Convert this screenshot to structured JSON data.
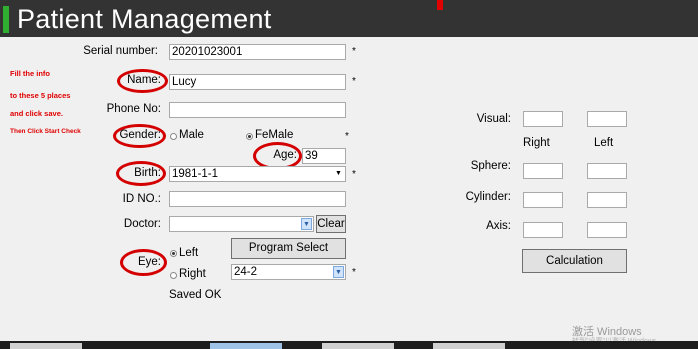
{
  "header": {
    "title": "Patient Management"
  },
  "hints": [
    "Fill the info",
    "to these 5 places",
    "and click save.",
    "Then Click Start Check"
  ],
  "form": {
    "serial_label": "Serial number:",
    "serial_value": "20201023001",
    "name_label": "Name:",
    "name_value": "Lucy",
    "phone_label": "Phone No:",
    "phone_value": "",
    "gender_label": "Gender:",
    "gender_male": "Male",
    "gender_female": "FeMale",
    "gender_selected": "FeMale",
    "age_label": "Age:",
    "age_value": "39",
    "birth_label": "Birth:",
    "birth_value": "1981-1-1",
    "id_label": "ID NO.:",
    "id_value": "",
    "doctor_label": "Doctor:",
    "doctor_value": "",
    "clear_button": "Clear",
    "eye_label": "Eye:",
    "eye_left": "Left",
    "eye_right": "Right",
    "eye_selected": "Left",
    "program_select_button": "Program Select",
    "program_value": "24-2",
    "status_text": "Saved OK",
    "required_mark": "*"
  },
  "vision": {
    "visual_label": "Visual:",
    "right_label": "Right",
    "left_label": "Left",
    "sphere_label": "Sphere:",
    "cylinder_label": "Cylinder:",
    "axis_label": "Axis:",
    "calculation_button": "Calculation"
  },
  "watermark": {
    "line1": "激活 Windows",
    "line2": "转到\"设置\"以激活 Windows。"
  },
  "colors": {
    "header_bg": "#333333",
    "accent_green": "#2fae2f",
    "highlight_red": "#d40000"
  }
}
